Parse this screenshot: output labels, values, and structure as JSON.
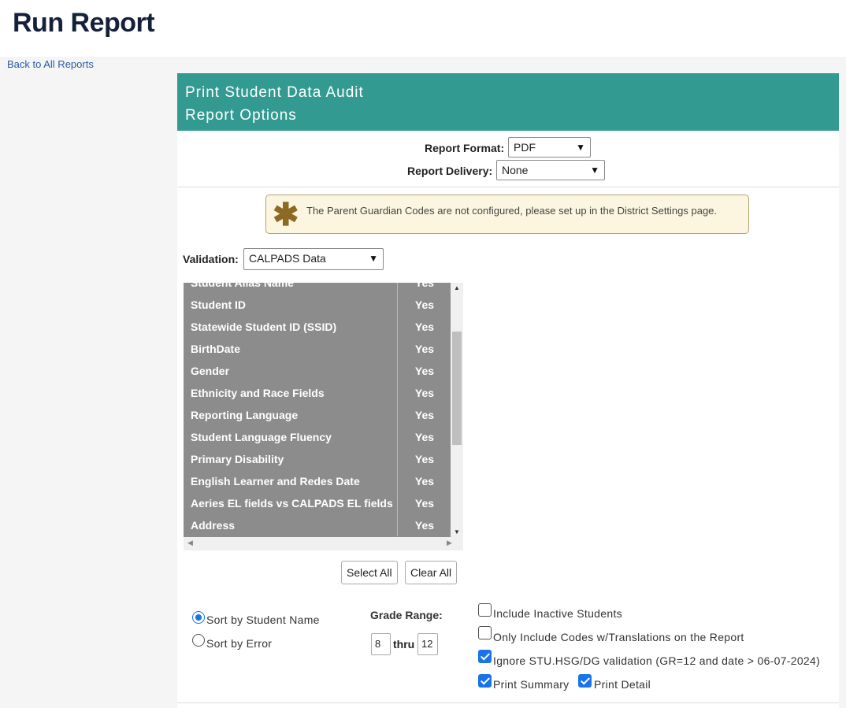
{
  "page": {
    "title": "Run Report",
    "back_link": "Back to All Reports"
  },
  "header": {
    "line1": "Print Student Data Audit",
    "line2": "Report Options"
  },
  "format": {
    "format_label": "Report Format:",
    "format_value": "PDF",
    "delivery_label": "Report Delivery:",
    "delivery_value": "None"
  },
  "alert": {
    "icon": "asterisk-icon",
    "message": "The Parent Guardian Codes are not configured, please set up in the District Settings page."
  },
  "validation": {
    "label": "Validation:",
    "value": "CALPADS Data"
  },
  "validation_list": {
    "rows": [
      {
        "name": "Student Alias Name",
        "value": "Yes"
      },
      {
        "name": "Student ID",
        "value": "Yes"
      },
      {
        "name": "Statewide Student ID (SSID)",
        "value": "Yes"
      },
      {
        "name": "BirthDate",
        "value": "Yes"
      },
      {
        "name": "Gender",
        "value": "Yes"
      },
      {
        "name": "Ethnicity and Race Fields",
        "value": "Yes"
      },
      {
        "name": "Reporting Language",
        "value": "Yes"
      },
      {
        "name": "Student Language Fluency",
        "value": "Yes"
      },
      {
        "name": "Primary Disability",
        "value": "Yes"
      },
      {
        "name": "English Learner and Redes Date",
        "value": "Yes"
      },
      {
        "name": "Aeries EL fields vs CALPADS EL fields",
        "value": "Yes"
      },
      {
        "name": "Address",
        "value": "Yes"
      }
    ]
  },
  "buttons": {
    "select_all": "Select All",
    "clear_all": "Clear All"
  },
  "sort": {
    "by_name": "Sort by Student Name",
    "by_error": "Sort by Error",
    "selected": "by_name"
  },
  "grade": {
    "label": "Grade Range:",
    "from": "8",
    "thru_label": "thru",
    "to": "12"
  },
  "options": {
    "include_inactive": {
      "label": "Include Inactive Students",
      "checked": false
    },
    "only_translations": {
      "label": "Only Include Codes w/Translations on the Report",
      "checked": false
    },
    "ignore_hsg": {
      "label": "Ignore STU.HSG/DG validation (GR=12 and date > 06-07-2024)",
      "checked": true
    },
    "print_summary": {
      "label": "Print Summary",
      "checked": true
    },
    "print_detail": {
      "label": "Print Detail",
      "checked": true
    }
  },
  "colors": {
    "header_bg": "#339a92",
    "list_bg": "#8c8c8c",
    "alert_bg": "#fcf6e0",
    "accent": "#1a73e8"
  }
}
